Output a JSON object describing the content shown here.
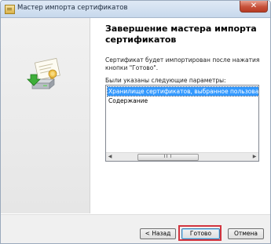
{
  "window": {
    "title": "Мастер импорта сертификатов",
    "close_glyph": "✕"
  },
  "main": {
    "heading": "Завершение мастера импорта сертификатов",
    "description": "Сертификат будет импортирован после нажатия кнопки \"Готово\".",
    "params_label": "Были указаны следующие параметры:",
    "params": [
      "Хранилище сертификатов, выбранное пользователем",
      "Содержание"
    ],
    "selected_index": 0,
    "scroll_left_glyph": "◀",
    "scroll_right_glyph": "▶"
  },
  "footer": {
    "back_label": "< Назад",
    "finish_label": "Готово",
    "cancel_label": "Отмена"
  },
  "icons": {
    "window_icon": "certificate-icon",
    "wizard_art": "certificate-install-icon",
    "highlight_color": "#d2353f"
  }
}
